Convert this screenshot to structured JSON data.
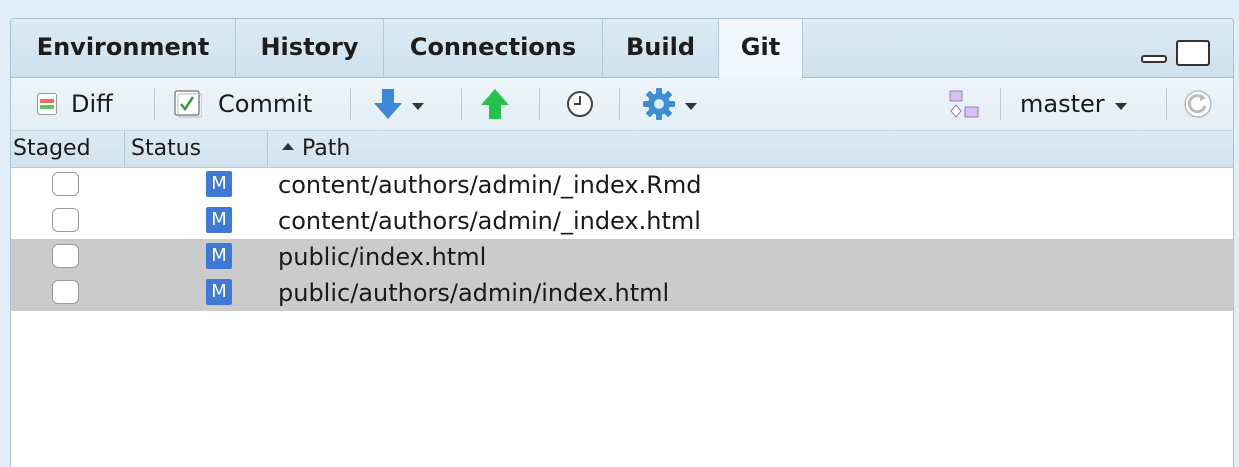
{
  "tabs": [
    {
      "label": "Environment",
      "active": false
    },
    {
      "label": "History",
      "active": false
    },
    {
      "label": "Connections",
      "active": false
    },
    {
      "label": "Build",
      "active": false
    },
    {
      "label": "Git",
      "active": true
    }
  ],
  "toolbar": {
    "diff_label": "Diff",
    "commit_label": "Commit",
    "branch_label": "master",
    "icons": [
      "diff-icon",
      "commit-icon",
      "pull-icon",
      "push-icon",
      "history-icon",
      "gear-icon",
      "new-branch-icon",
      "refresh-icon"
    ]
  },
  "columns": {
    "staged": "Staged",
    "status": "Status",
    "path": "Path",
    "sort": "ascending"
  },
  "files": [
    {
      "staged": false,
      "status": "M",
      "path": "content/authors/admin/_index.Rmd",
      "selected": false
    },
    {
      "staged": false,
      "status": "M",
      "path": "content/authors/admin/_index.html",
      "selected": false
    },
    {
      "staged": false,
      "status": "M",
      "path": "public/index.html",
      "selected": true
    },
    {
      "staged": false,
      "status": "M",
      "path": "public/authors/admin/index.html",
      "selected": true
    }
  ],
  "colors": {
    "status_badge": "#3f7ad9",
    "selection": "#cbcbcb",
    "push_arrow": "#27c24b",
    "pull_arrow": "#3b87d8"
  }
}
